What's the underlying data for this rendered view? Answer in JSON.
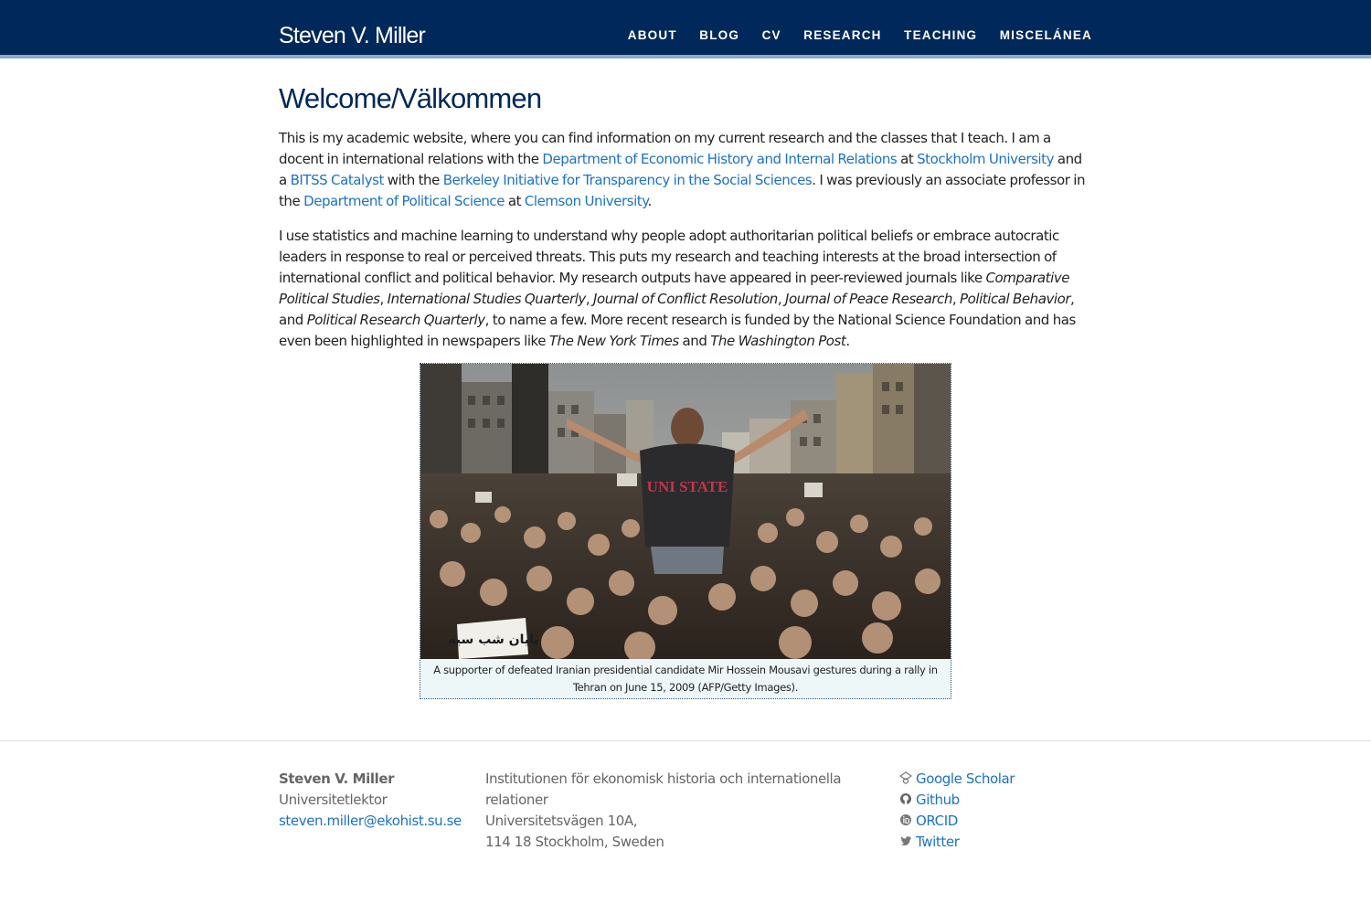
{
  "header": {
    "brand": "Steven V. Miller",
    "nav": [
      "ABOUT",
      "BLOG",
      "CV",
      "RESEARCH",
      "TEACHING",
      "MISCELÁNEA"
    ]
  },
  "main": {
    "title": "Welcome/Välkommen",
    "p1": {
      "t1": "This is my academic website, where you can find information on my current research and the classes that I teach. I am a docent in international relations with the ",
      "l1": "Department of Economic History and Internal Relations",
      "t2": " at ",
      "l2": "Stockholm University",
      "t3": " and a ",
      "l3": "BITSS Catalyst",
      "t4": " with the ",
      "l4": "Berkeley Initiative for Transparency in the Social Sciences",
      "t5": ". I was previously an associate professor in the ",
      "l5": "Department of Political Science",
      "t6": " at ",
      "l6": "Clemson University",
      "t7": "."
    },
    "p2": {
      "t1": "I use statistics and machine learning to understand why people adopt authoritarian political beliefs or embrace autocratic leaders in response to real or perceived threats. This puts my research and teaching interests at the broad intersection of international conflict and political behavior. My research outputs have appeared in peer-reviewed journals like ",
      "j1": "Comparative Political Studies",
      "s1": ", ",
      "j2": "International Studies Quarterly",
      "s2": ", ",
      "j3": "Journal of Conflict Resolution",
      "s3": ", ",
      "j4": "Journal of Peace Research",
      "s4": ", ",
      "j5": "Political Behavior",
      "s5": ", and ",
      "j6": "Political Research Quarterly",
      "t2": ", to name a few. More recent research is funded by the National Science Foundation and has even been highlighted in newspapers like ",
      "n1": "The New York Times",
      "t3": " and ",
      "n2": "The Washington Post",
      "t4": "."
    },
    "figure": {
      "caption": "A supporter of defeated Iranian presidential candidate Mir Hossein Mousavi gestures during a rally in Tehran on June 15, 2009 (AFP/Getty Images).",
      "sign_text": "پایان شب سیه",
      "shirt_text": "UNI STATE"
    }
  },
  "footer": {
    "name": "Steven V. Miller",
    "role": "Universitetlektor",
    "email": "steven.miller@ekohist.su.se",
    "address": [
      "Institutionen för ekonomisk historia och internationella",
      "relationer",
      "Universitetsvägen 10A,",
      "114 18 Stockholm, Sweden"
    ],
    "links": [
      {
        "icon": "google-scholar-icon",
        "label": "Google Scholar"
      },
      {
        "icon": "github-icon",
        "label": "Github"
      },
      {
        "icon": "orcid-icon",
        "label": "ORCID"
      },
      {
        "icon": "twitter-icon",
        "label": "Twitter"
      }
    ]
  },
  "colors": {
    "navbar": "#00285a",
    "navbar_rule": "#8da9cc",
    "link": "#1c72c5",
    "title": "#00285a"
  }
}
